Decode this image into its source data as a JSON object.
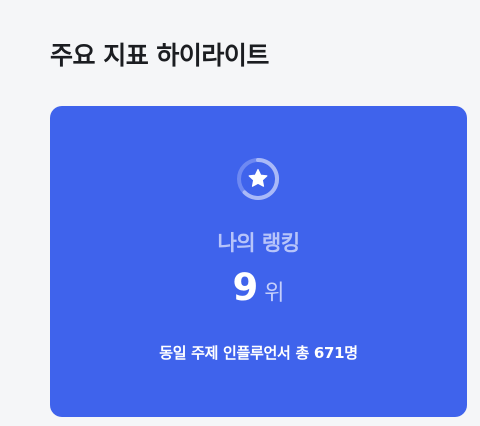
{
  "section": {
    "title": "주요 지표 하이라이트"
  },
  "card": {
    "icon": "star-badge-icon",
    "background_color": "#3F63EC",
    "label": "나의 랭킹",
    "rank_value": "9",
    "rank_unit": "위",
    "total_text": "동일 주제 인플루언서 총 671명"
  }
}
